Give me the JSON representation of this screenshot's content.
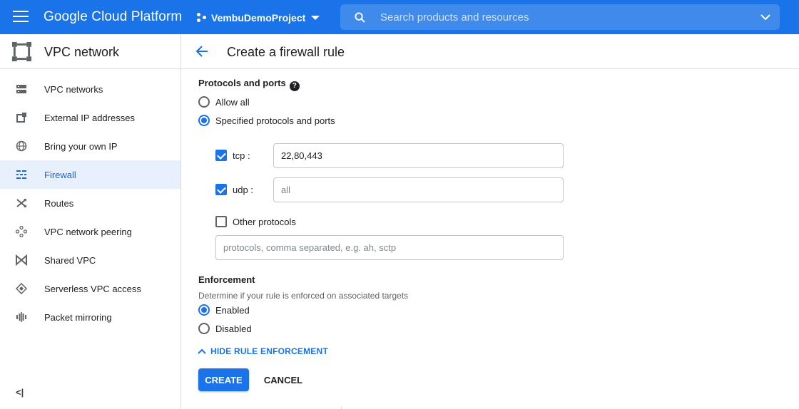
{
  "header": {
    "brand": "Google Cloud Platform",
    "project": "VembuDemoProject",
    "search_placeholder": "Search products and resources",
    "colors": {
      "bar": "#1a73e8"
    }
  },
  "sidebar": {
    "title": "VPC network",
    "items": [
      {
        "label": "VPC networks",
        "icon": "vpc-networks-icon",
        "active": false
      },
      {
        "label": "External IP addresses",
        "icon": "external-ip-icon",
        "active": false
      },
      {
        "label": "Bring your own IP",
        "icon": "globe-icon",
        "active": false
      },
      {
        "label": "Firewall",
        "icon": "firewall-icon",
        "active": true
      },
      {
        "label": "Routes",
        "icon": "routes-icon",
        "active": false
      },
      {
        "label": "VPC network peering",
        "icon": "peering-icon",
        "active": false
      },
      {
        "label": "Shared VPC",
        "icon": "shared-vpc-icon",
        "active": false
      },
      {
        "label": "Serverless VPC access",
        "icon": "serverless-icon",
        "active": false
      },
      {
        "label": "Packet mirroring",
        "icon": "packet-mirroring-icon",
        "active": false
      }
    ],
    "collapse_label": "<|"
  },
  "page": {
    "title": "Create a firewall rule"
  },
  "protocols": {
    "label": "Protocols and ports",
    "help": "?",
    "allow_all": "Allow all",
    "specified": "Specified protocols and ports",
    "selected": "specified",
    "tcp": {
      "label": "tcp :",
      "checked": true,
      "value": "22,80,443"
    },
    "udp": {
      "label": "udp :",
      "checked": true,
      "placeholder": "all"
    },
    "other": {
      "label": "Other protocols",
      "checked": false,
      "placeholder": "protocols, comma separated, e.g. ah, sctp"
    }
  },
  "enforcement": {
    "label": "Enforcement",
    "hint": "Determine if your rule is enforced on associated targets",
    "enabled": "Enabled",
    "disabled": "Disabled",
    "selected": "enabled",
    "toggle_label": "HIDE RULE ENFORCEMENT"
  },
  "actions": {
    "create": "CREATE",
    "cancel": "CANCEL"
  }
}
